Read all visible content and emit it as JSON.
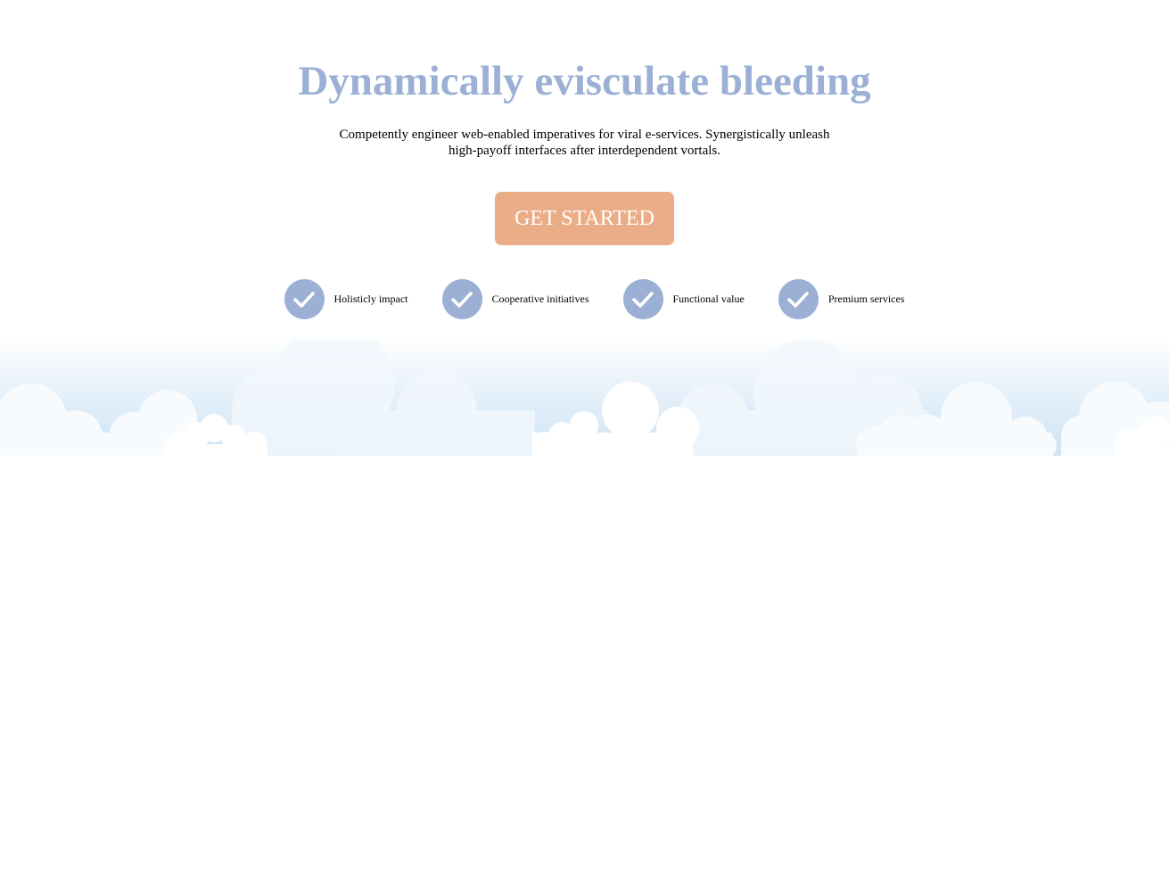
{
  "hero": {
    "title": "Dynamically evisculate bleeding",
    "subtitle": "Competently engineer web-enabled imperatives for viral e-services. Synergistically unleash high-payoff interfaces after interdependent vortals.",
    "cta_label": "GET STARTED"
  },
  "features": [
    {
      "label": "Holisticly impact",
      "icon": "check-icon"
    },
    {
      "label": "Cooperative initiatives",
      "icon": "check-icon"
    },
    {
      "label": "Functional value",
      "icon": "check-icon"
    },
    {
      "label": "Premium services",
      "icon": "check-icon"
    }
  ],
  "colors": {
    "title": "#9bb0d4",
    "cta_background": "#ebad88",
    "check_circle": "#9bb0d4",
    "sky": "#cfe5f5"
  }
}
